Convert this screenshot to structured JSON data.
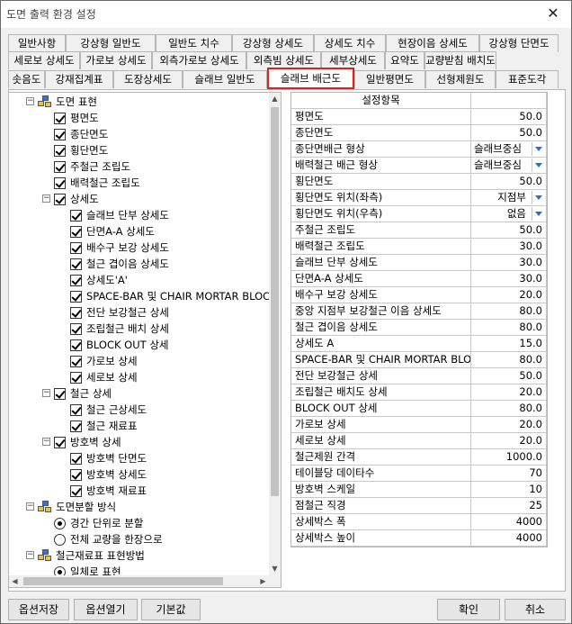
{
  "window": {
    "title": "도면 출력 환경 설정",
    "close_glyph": "✕"
  },
  "tabs": {
    "row1": [
      "일반사항",
      "강상형 일반도",
      "일반도 치수",
      "강상형 상세도",
      "상세도 치수",
      "현장이음 상세도",
      "강상형 단면도"
    ],
    "row2": [
      "세로보 상세도",
      "가로보 상세도",
      "외측가로보 상세도",
      "외측빔 상세도",
      "세부상세도",
      "요약도",
      "교량받침 배치도"
    ],
    "row3": [
      "솟음도",
      "강재집계표",
      "도장상세도",
      "슬래브 일반도",
      "슬래브 배근도",
      "일반평면도",
      "선형제원도",
      "표준도각"
    ],
    "active": "슬래브 배근도"
  },
  "tree": {
    "root1": "도면 표현",
    "items_a": [
      "평면도",
      "종단면도",
      "횡단면도",
      "주철근 조립도",
      "배력철근 조립도"
    ],
    "group_detail": "상세도",
    "items_detail": [
      "슬래브 단부 상세도",
      "단면A-A 상세도",
      "배수구 보강 상세도",
      "철근 겹이음 상세도",
      "상세도'A'",
      "SPACE-BAR 및 CHAIR MORTAR BLOCK 상세",
      "전단 보강철근 상세",
      "조립철근 배치 상세",
      "BLOCK OUT 상세",
      "가로보 상세",
      "세로보 상세"
    ],
    "group_rebar": "철근 상세",
    "items_rebar": [
      "철근 근상세도",
      "철근 재료표"
    ],
    "group_barrier": "방호벽 상세",
    "items_barrier": [
      "방호벽 단면도",
      "방호벽 상세도",
      "방호벽 재료표"
    ],
    "root2": "도면분할 방식",
    "split_options": [
      "경간 단위로 분할",
      "전체 교량을 한장으로"
    ],
    "root3": "철근재료표 표현방법",
    "table_options": [
      "일체로 표현"
    ]
  },
  "grid": {
    "header": "설정항목",
    "rows": [
      {
        "k": "평면도",
        "v": "50.0"
      },
      {
        "k": "종단면도",
        "v": "50.0"
      },
      {
        "k": "종단면배근 형상",
        "v": "슬래브중심",
        "dd": true
      },
      {
        "k": "배력철근 배근 형상",
        "v": "슬래브중심",
        "dd": true
      },
      {
        "k": "횡단면도",
        "v": "50.0"
      },
      {
        "k": "횡단면도 위치(좌측)",
        "v": "지점부",
        "dd": true,
        "right": true
      },
      {
        "k": "횡단면도 위치(우측)",
        "v": "없음",
        "dd": true,
        "right": true
      },
      {
        "k": "주철근 조립도",
        "v": "50.0"
      },
      {
        "k": "배력철근 조립도",
        "v": "30.0"
      },
      {
        "k": "슬래브 단부 상세도",
        "v": "30.0"
      },
      {
        "k": "단면A-A 상세도",
        "v": "30.0"
      },
      {
        "k": "배수구 보강 상세도",
        "v": "20.0"
      },
      {
        "k": "중앙 지점부 보강철근 이음 상세도",
        "v": "80.0"
      },
      {
        "k": "철근 겹이음 상세도",
        "v": "80.0"
      },
      {
        "k": "상세도 A",
        "v": "15.0"
      },
      {
        "k": "SPACE-BAR 및 CHAIR MORTAR BLOCK",
        "v": "80.0"
      },
      {
        "k": "전단 보강철근 상세",
        "v": "50.0"
      },
      {
        "k": "조립철근 배치도 상세",
        "v": "20.0"
      },
      {
        "k": "BLOCK OUT  상세",
        "v": "80.0"
      },
      {
        "k": "가로보 상세",
        "v": "20.0"
      },
      {
        "k": "세로보 상세",
        "v": "20.0"
      },
      {
        "k": "철근제원 간격",
        "v": "1000.0"
      },
      {
        "k": "테이블당 데이타수",
        "v": "70"
      },
      {
        "k": "방호벽 스케일",
        "v": "10"
      },
      {
        "k": "점철근 직경",
        "v": "25"
      },
      {
        "k": "상세박스 폭",
        "v": "4000"
      },
      {
        "k": "상세박스 높이",
        "v": "4000"
      }
    ]
  },
  "buttons": {
    "save": "옵션저장",
    "open": "옵션열기",
    "default": "기본값",
    "ok": "확인",
    "cancel": "취소"
  }
}
